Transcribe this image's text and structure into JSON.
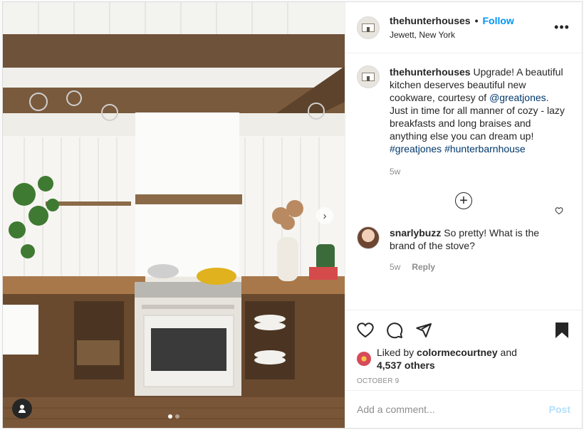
{
  "colors": {
    "brand": "#0095f6",
    "text": "#262626",
    "muted": "#8e8e8e",
    "link": "#00376b"
  },
  "header": {
    "username": "thehunterhouses",
    "separator": "•",
    "follow_label": "Follow",
    "location": "Jewett, New York",
    "more_icon": "more-horizontal-icon"
  },
  "caption": {
    "username": "thehunterhouses",
    "text_1": "Upgrade! A beautiful kitchen deserves beautiful new cookware, courtesy of",
    "mention": "@greatjones",
    "text_2": ". Just in time for all manner of cozy - lazy breakfasts and long braises and anything else you can dream up!",
    "hashtag_1": "#greatjones",
    "hashtag_2": "#hunterbarnhouse",
    "time": "5w"
  },
  "load_more": "+",
  "comment": {
    "username": "snarlybuzz",
    "text": "So pretty! What is the brand of the stove?",
    "time": "5w",
    "reply_label": "Reply"
  },
  "actions": {
    "like_icon": "heart-icon",
    "comment_icon": "comment-icon",
    "share_icon": "share-icon",
    "save_icon": "bookmark-icon"
  },
  "likes": {
    "prefix": "Liked by",
    "user": "colormecourtney",
    "middle": "and",
    "count": "4,537 others"
  },
  "date": "OCTOBER 9",
  "add_comment": {
    "placeholder": "Add a comment...",
    "post_label": "Post"
  },
  "media": {
    "next_icon": "chevron-right-icon",
    "tag_icon": "user-tag-icon",
    "slide_index": 1,
    "slide_count": 2
  }
}
